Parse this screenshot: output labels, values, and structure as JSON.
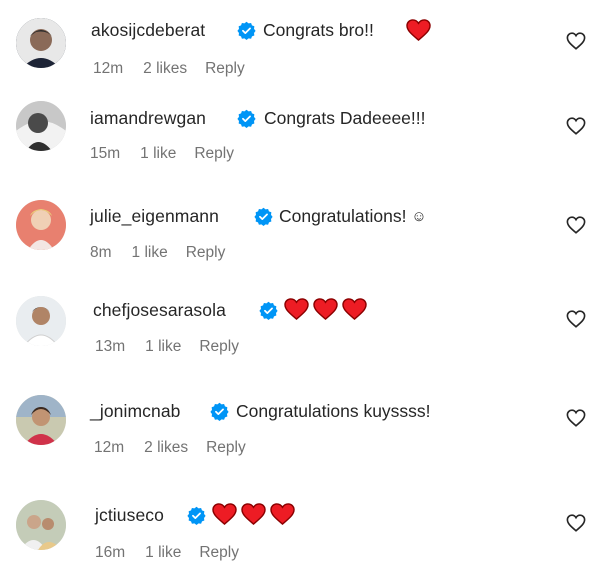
{
  "comments": [
    {
      "username": "akosijcdeberat",
      "text": "Congrats bro!!",
      "time": "12m",
      "likes": "2 likes",
      "reply": "Reply",
      "emoji": "heart",
      "verified": true
    },
    {
      "username": "iamandrewgan",
      "text": "Congrats Dadeeee!!!",
      "time": "15m",
      "likes": "1 like",
      "reply": "Reply",
      "verified": true
    },
    {
      "username": "julie_eigenmann",
      "text": "Congratulations!",
      "emoji_char": "☺",
      "time": "8m",
      "likes": "1 like",
      "reply": "Reply",
      "verified": true
    },
    {
      "username": "chefjosesarasola",
      "text": "",
      "time": "13m",
      "likes": "1 like",
      "reply": "Reply",
      "emoji": "heart x3",
      "verified": true
    },
    {
      "username": "_jonimcnab",
      "text": "Congratulations kuyssss!",
      "time": "12m",
      "likes": "2 likes",
      "reply": "Reply",
      "verified": true
    },
    {
      "username": "jctiuseco",
      "text": "",
      "time": "16m",
      "likes": "1 like",
      "reply": "Reply",
      "emoji": "heart x3",
      "verified": true
    }
  ],
  "colors": {
    "verified_blue": "#0095f6",
    "meta_gray": "#737373",
    "text": "#262626",
    "heart_red": "#ed1c24"
  },
  "icons": {
    "verified": "verified-badge-icon",
    "like": "heart-outline-icon",
    "emoji_heart": "red-heart-emoji"
  }
}
